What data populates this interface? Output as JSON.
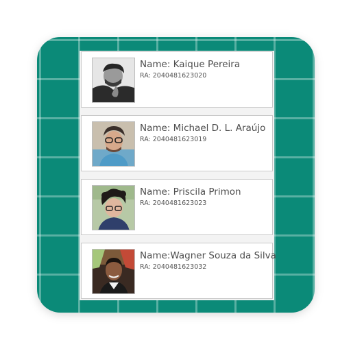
{
  "app": {
    "background_color": "#0b8a78",
    "grid_line_color": "#ffffffcc"
  },
  "students": [
    {
      "name_text": "Name: Kaique Pereira",
      "ra_text": "RA: 2040481623020",
      "photo": "grayscale-portrait"
    },
    {
      "name_text": "Name: Michael D. L. Araújo",
      "ra_text": "RA: 2040481623019",
      "photo": "portrait-glasses-cap"
    },
    {
      "name_text": "Name: Priscila Primon",
      "ra_text": "RA: 2040481623023",
      "photo": "portrait-curly-hair-glasses"
    },
    {
      "name_text": "Name:Wagner Souza da Silva",
      "ra_text": "RA: 2040481623032",
      "photo": "portrait-outdoor"
    }
  ]
}
